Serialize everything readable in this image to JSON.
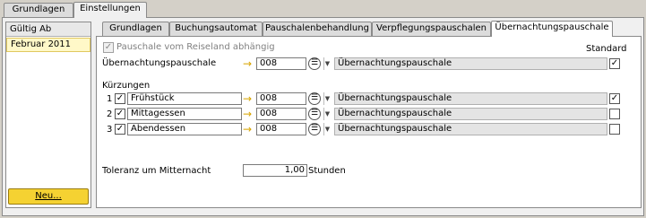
{
  "outer_tabs": [
    "Grundlagen",
    "Einstellungen"
  ],
  "left": {
    "header": "Gültig Ab",
    "rows": [
      "Februar 2011"
    ],
    "new_button": "Neu..."
  },
  "inner_tabs": [
    "Grundlagen",
    "Buchungsautomat",
    "Pauschalenbehandlung",
    "Verpflegungspauschalen",
    "Übernachtungspauschale"
  ],
  "form": {
    "pauschale_label": "Pauschale vom Reiseland abhängig",
    "standard_label": "Standard",
    "main_label": "Übernachtungspauschale",
    "main_code": "008",
    "main_desc": "Übernachtungspauschale",
    "kuerzungen_label": "Kürzungen",
    "kuerzungen": [
      {
        "num": "1",
        "label": "Frühstück",
        "code": "008",
        "desc": "Übernachtungspauschale",
        "std": "✓"
      },
      {
        "num": "2",
        "label": "Mittagessen",
        "code": "008",
        "desc": "Übernachtungspauschale",
        "std": ""
      },
      {
        "num": "3",
        "label": "Abendessen",
        "code": "008",
        "desc": "Übernachtungspauschale",
        "std": ""
      }
    ],
    "toleranz_label": "Toleranz um Mitternacht",
    "toleranz_value": "1,00",
    "toleranz_unit": "Stunden"
  },
  "icons": {
    "arrow": "→",
    "list": "☰",
    "dropdown": "▼",
    "check": "✓"
  }
}
